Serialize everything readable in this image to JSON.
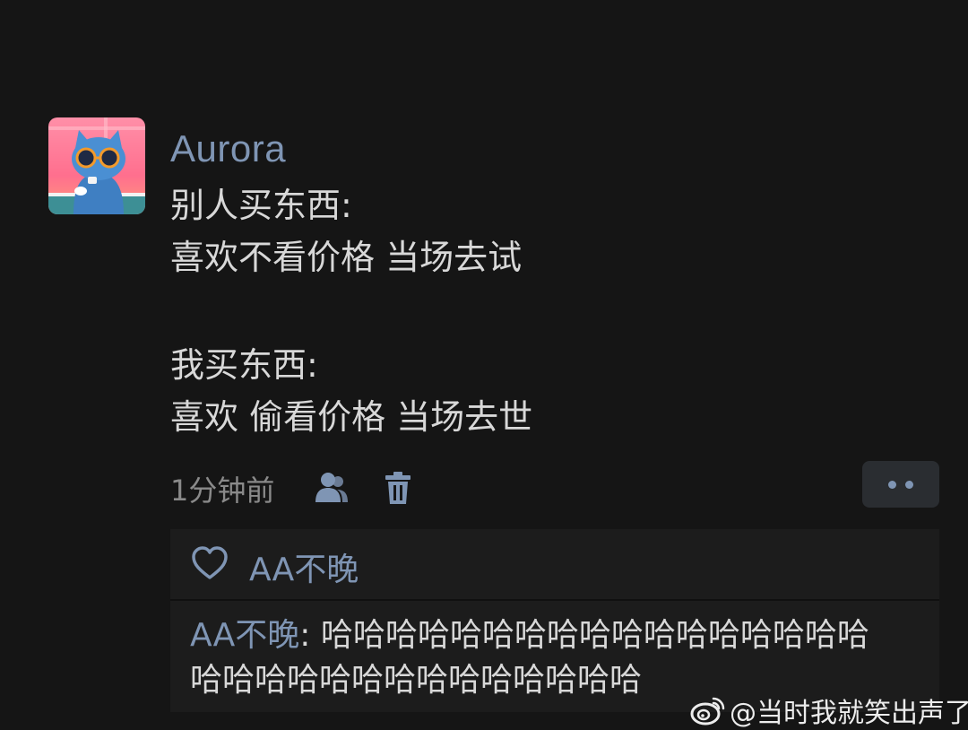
{
  "post": {
    "username": "Aurora",
    "content_lines_top": [
      "别人买东西:",
      "喜欢不看价格 当场去试"
    ],
    "content_lines_bottom": [
      "我买东西:",
      "喜欢 偷看价格 当场去世"
    ],
    "timestamp": "1分钟前"
  },
  "comments": {
    "liker": "AA不晚",
    "comment": {
      "author": "AA不晚",
      "separator": ": ",
      "text_line1": "哈哈哈哈哈哈哈哈哈哈哈哈哈哈哈哈哈",
      "text_line2": "哈哈哈哈哈哈哈哈哈哈哈哈哈哈"
    }
  },
  "watermark": {
    "text": "@当时我就笑出声了",
    "icon": "weibo-logo-icon"
  },
  "colors": {
    "background": "#151515",
    "accent_name": "#7f95b4",
    "body_text": "#d8d8d8",
    "muted_text": "#8a8a8a",
    "comment_panel": "#1c1c1c",
    "more_button": "#2a2d31"
  },
  "icons": {
    "avatar": "cat-with-sunglasses-avatar",
    "friends": "friends-icon",
    "delete": "trash-icon",
    "more": "more-dots-icon",
    "like": "heart-icon"
  }
}
